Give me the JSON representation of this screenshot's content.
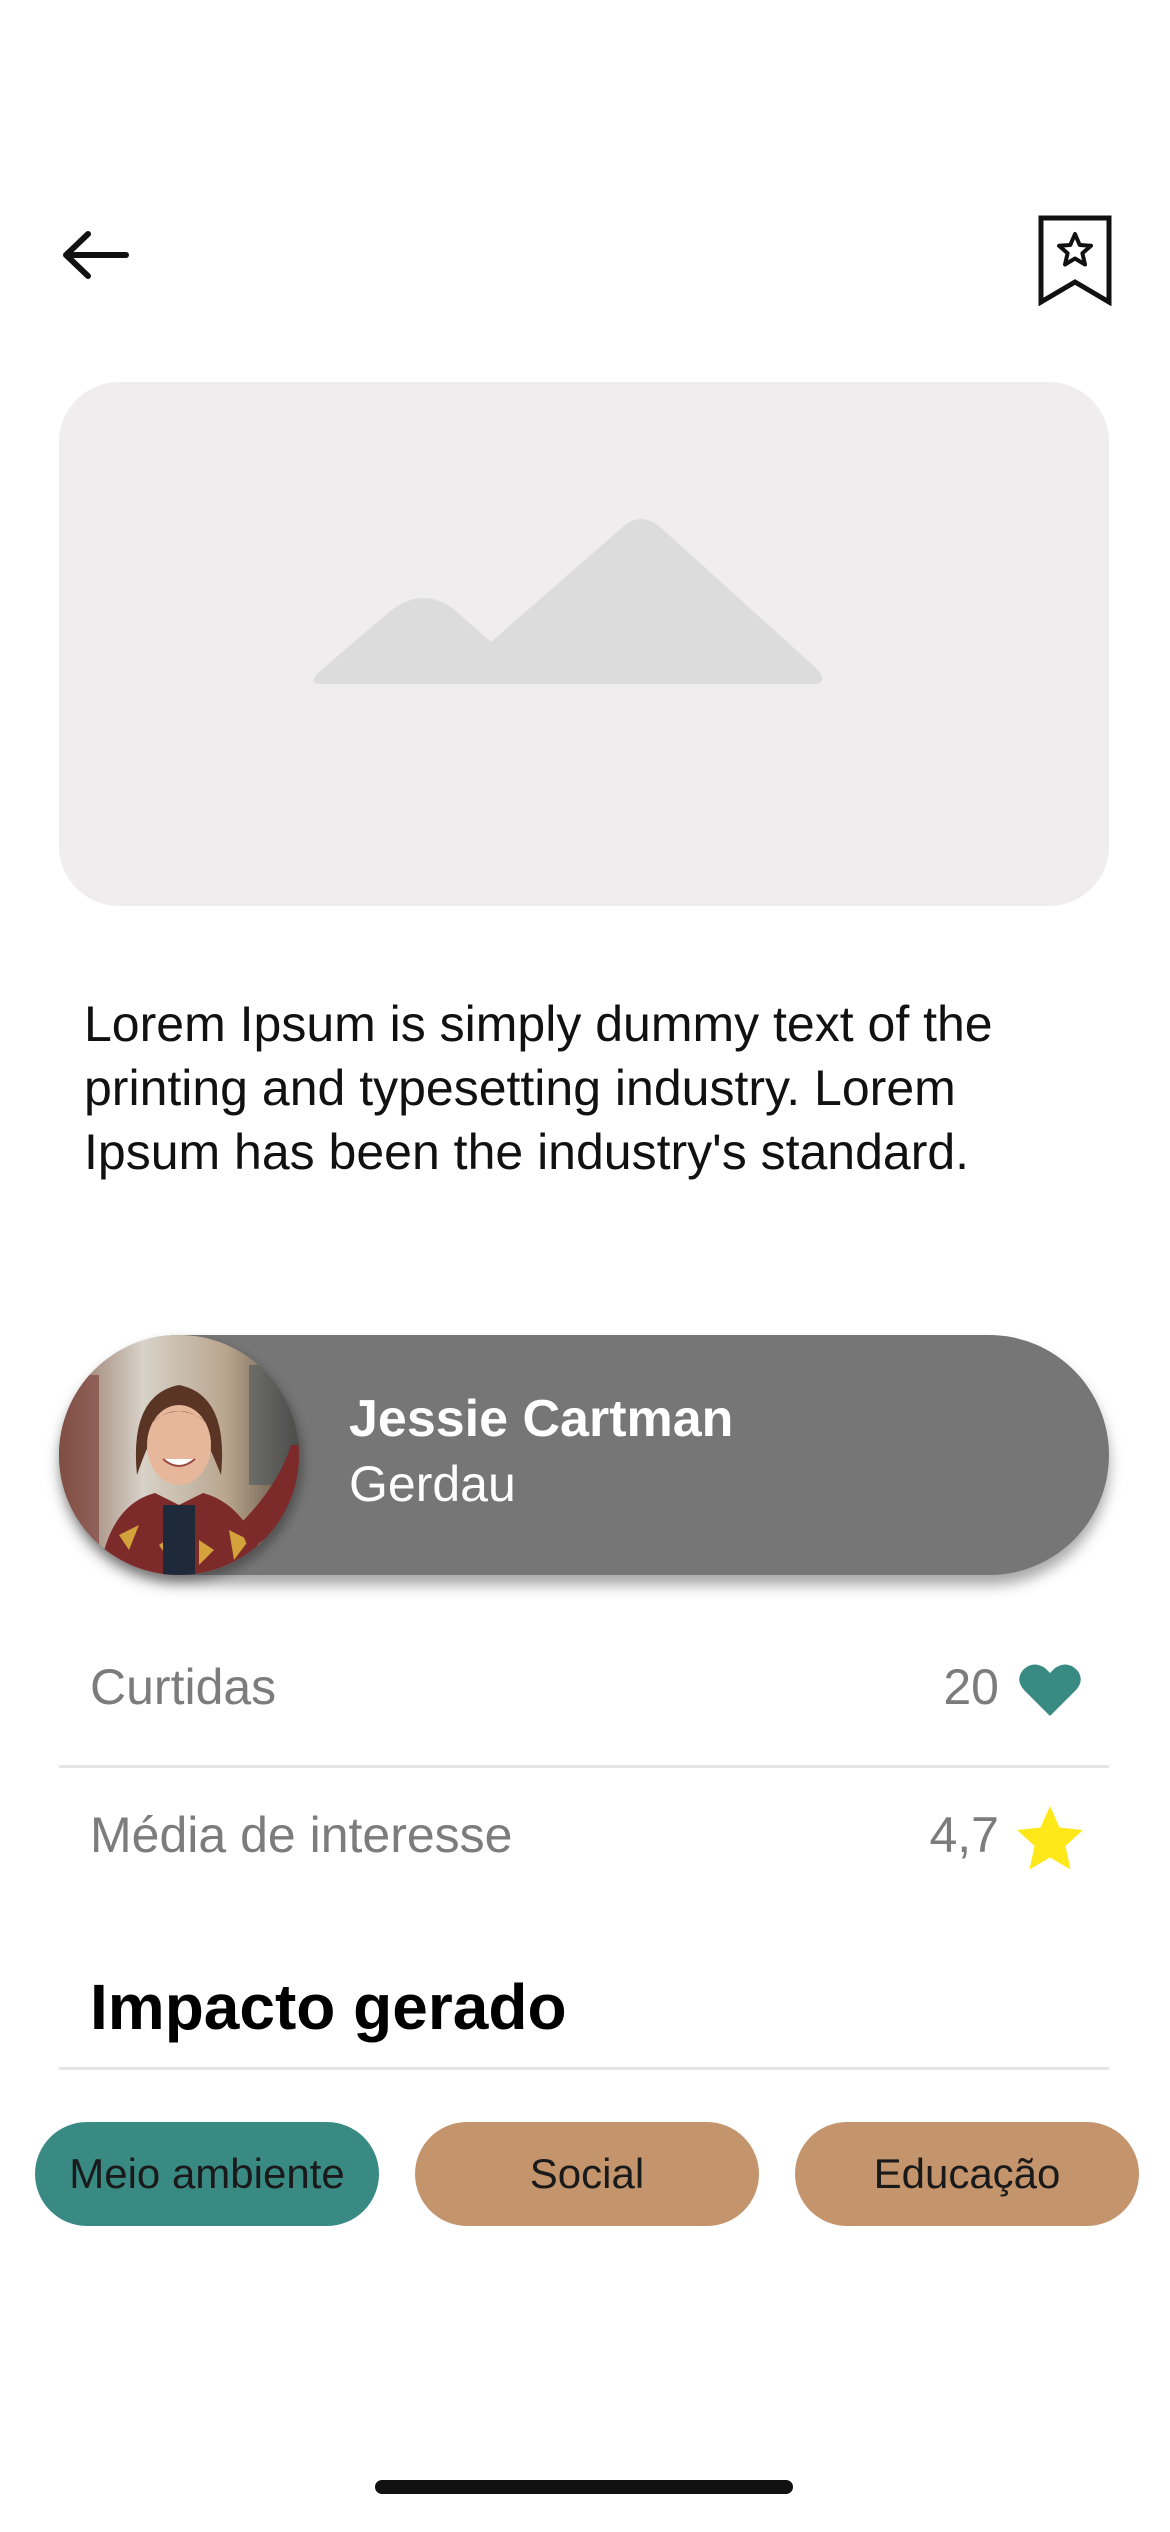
{
  "header": {
    "back_icon": "arrow-left-icon",
    "bookmark_icon": "bookmark-star-icon"
  },
  "hero": {
    "icon": "image-placeholder-icon",
    "bg_color": "#efeded"
  },
  "description": "Lorem Ipsum is simply dummy text of the printing and typesetting industry. Lorem Ipsum has been the industry's standard.",
  "author": {
    "name": "Jessie Cartman",
    "company": "Gerdau",
    "card_color": "#767676"
  },
  "stats": [
    {
      "label": "Curtidas",
      "value": "20",
      "icon": "heart-icon",
      "icon_color": "#3a8a84"
    },
    {
      "label": "Média de interesse",
      "value": "4,7",
      "icon": "star-icon",
      "icon_color": "#ffe81a"
    }
  ],
  "impact": {
    "title": "Impacto gerado",
    "tags": [
      {
        "label": "Meio ambiente",
        "color": "#3a8a84",
        "selected": true
      },
      {
        "label": "Social",
        "color": "#c4946c",
        "selected": false
      },
      {
        "label": "Educação",
        "color": "#c4946c",
        "selected": false
      }
    ]
  }
}
